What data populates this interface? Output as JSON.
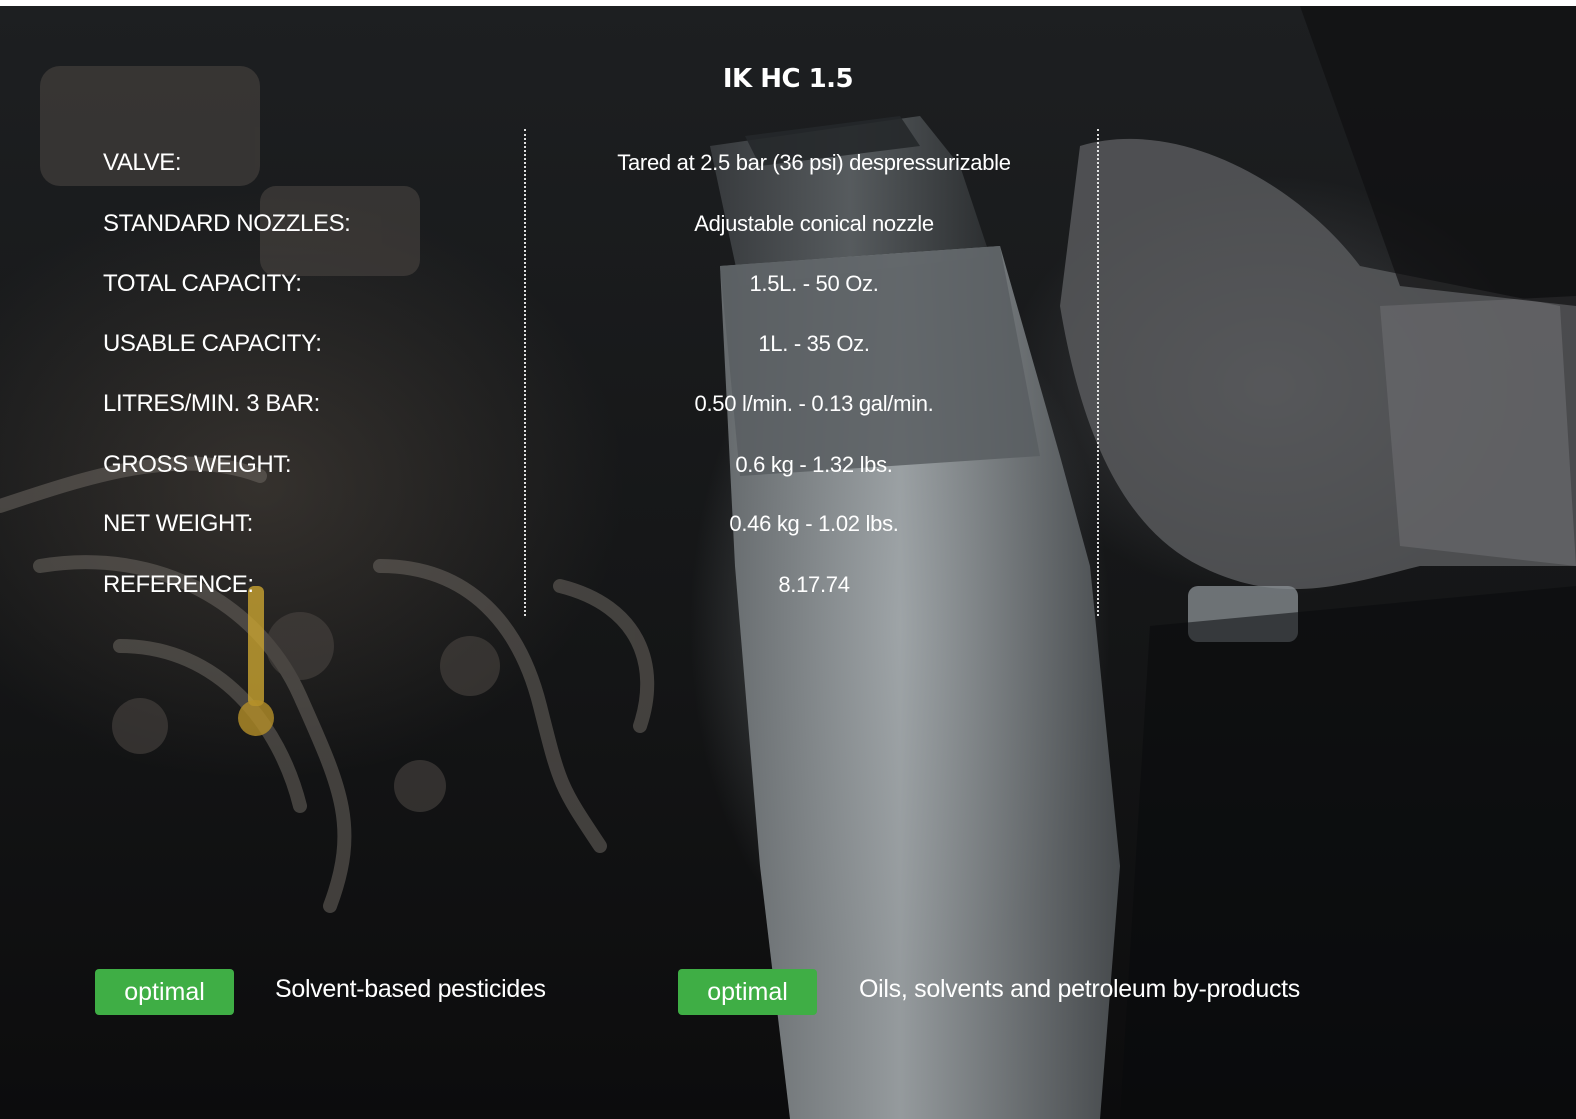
{
  "title": "IK HC 1.5",
  "specs": [
    {
      "label": "VALVE:",
      "value": "Tared at 2.5 bar (36 psi) despressurizable"
    },
    {
      "label": "STANDARD NOZZLES:",
      "value": "Adjustable conical nozzle"
    },
    {
      "label": "TOTAL CAPACITY:",
      "value": "1.5L. - 50 Oz."
    },
    {
      "label": "USABLE CAPACITY:",
      "value": "1L. - 35 Oz."
    },
    {
      "label": "LITRES/MIN. 3 BAR:",
      "value": "0.50 l/min. - 0.13 gal/min."
    },
    {
      "label": "GROSS WEIGHT:",
      "value": "0.6 kg - 1.32 lbs."
    },
    {
      "label": "NET WEIGHT:",
      "value": "0.46 kg - 1.02 lbs."
    },
    {
      "label": "REFERENCE:",
      "value": "8.17.74"
    }
  ],
  "compatibility": [
    {
      "badge": "optimal",
      "text": "Solvent-based pesticides"
    },
    {
      "badge": "optimal",
      "text": "Oils, solvents and petroleum by-products"
    }
  ],
  "colors": {
    "badge_green": "#3fae45",
    "text": "#ffffff",
    "background": "#141516"
  }
}
